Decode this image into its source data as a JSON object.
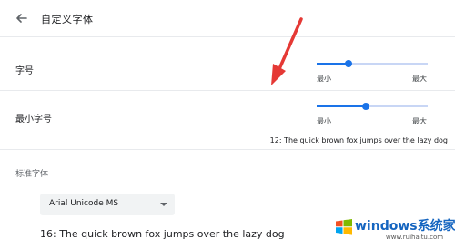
{
  "header": {
    "title": "自定义字体",
    "back_icon": "arrow-left-icon"
  },
  "font_size": {
    "label": "字号",
    "min_label": "最小",
    "max_label": "最大",
    "value_fraction": 0.29
  },
  "min_font_size": {
    "label": "最小字号",
    "min_label": "最小",
    "max_label": "最大",
    "value_fraction": 0.44,
    "sample": "12: The quick brown fox jumps over the lazy dog"
  },
  "standard_font": {
    "label": "标准字体",
    "selected": "Arial Unicode MS",
    "sample": "16: The quick brown fox jumps over the lazy dog"
  },
  "watermark": {
    "brand": "windows系统家园",
    "url": "www.ruihaitu.com"
  },
  "colors": {
    "accent": "#1a73e8",
    "track": "#c8d6f5",
    "annotation": "#e53935"
  }
}
